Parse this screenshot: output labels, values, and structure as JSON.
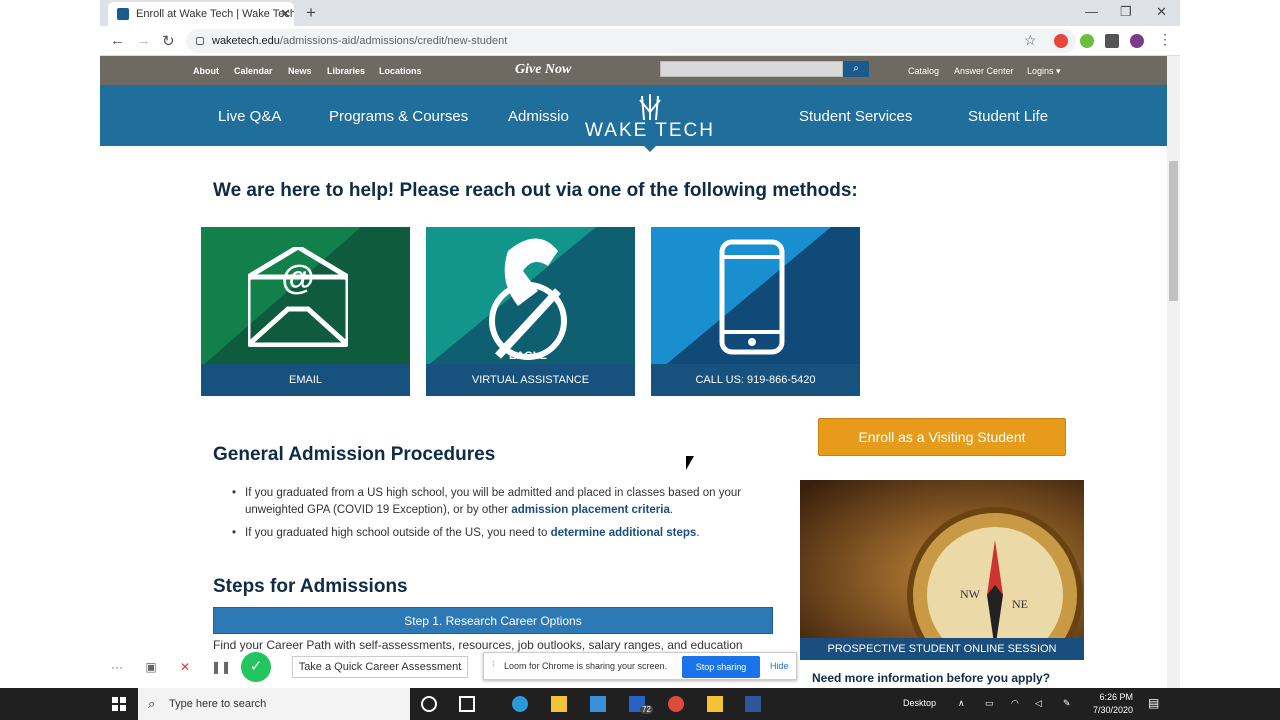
{
  "browser": {
    "tab_title": "Enroll at Wake Tech | Wake Tech",
    "url_domain": "waketech.edu",
    "url_path": "/admissions-aid/admissions/credit/new-student"
  },
  "topnav": {
    "links": [
      "About",
      "Calendar",
      "News",
      "Libraries",
      "Locations"
    ],
    "give_now": "Give Now",
    "right_links": [
      "Catalog",
      "Answer Center",
      "Logins ▾"
    ]
  },
  "mainnav": {
    "items": [
      "Live Q&A",
      "Programs & Courses",
      "Admissio",
      "Student Services",
      "Student Life"
    ],
    "logo_text": "WAKE TECH"
  },
  "help": {
    "heading": "We are here to help! Please reach out via one of the following methods:",
    "cards": [
      {
        "label": "EMAIL",
        "color": "#11804a"
      },
      {
        "label": "VIRTUAL ASSISTANCE",
        "color": "#12958a"
      },
      {
        "label": "CALL US: 919-866-5420",
        "color": "#1a8fd0"
      }
    ]
  },
  "enroll_button": "Enroll as a Visiting Student",
  "admission": {
    "heading": "General Admission Procedures",
    "item1_text": "If you graduated from a US high school, you will be admitted and placed in classes based on your unweighted GPA (COVID 19 Exception), or by other",
    "item1_link": "admission placement criteria",
    "item2_text": "If you graduated high school outside of the US, you need to",
    "item2_link": "determine additional steps"
  },
  "sidebar": {
    "photo_caption": "PROSPECTIVE STUDENT ONLINE SESSION",
    "need_more": "Need more information before you apply?"
  },
  "steps": {
    "heading": "Steps for Admissions",
    "step1": "Step 1. Research Career Options",
    "step1_text": "Find your Career Path with self-assessments, resources, job outlooks, salary ranges, and education"
  },
  "loom": {
    "quick_button": "Take a Quick Career Assessment",
    "share_msg": "Loom for Chrome is sharing your screen.",
    "stop": "Stop sharing",
    "hide": "Hide"
  },
  "taskbar": {
    "search_placeholder": "Type here to search",
    "desktop": "Desktop",
    "time": "6:26 PM",
    "date": "7/30/2020",
    "mail_badge": "72"
  }
}
